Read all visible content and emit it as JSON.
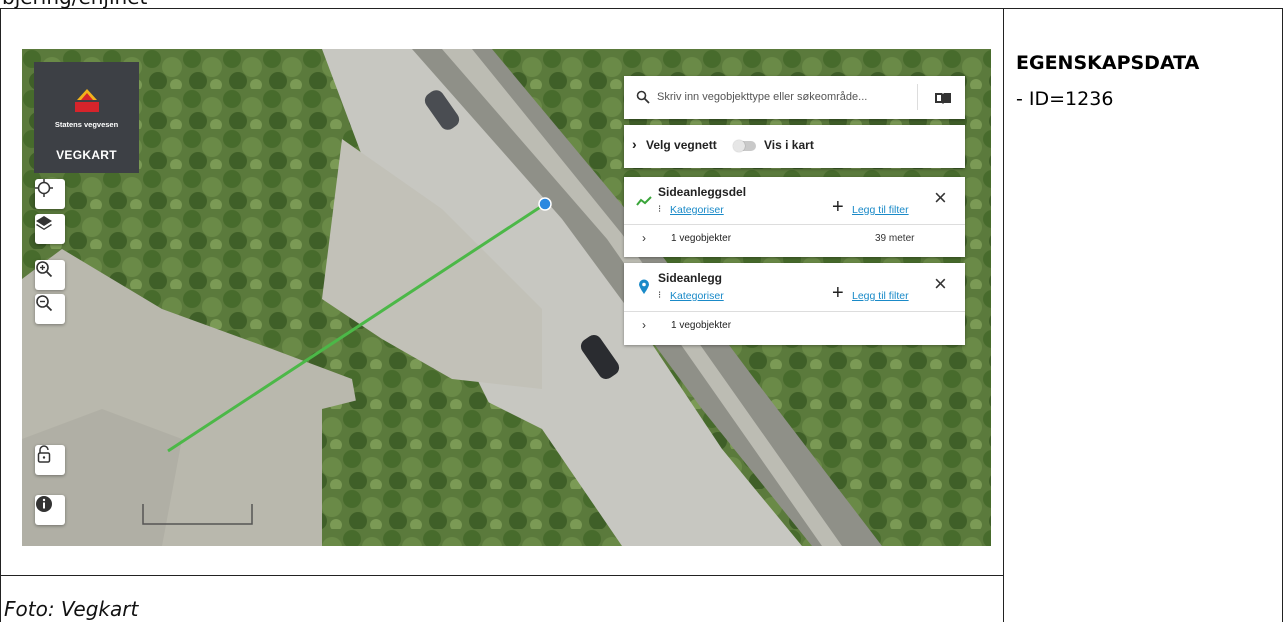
{
  "header": {
    "text": "bjering/ehjinet"
  },
  "right_panel": {
    "title": "EGENSKAPSDATA",
    "line1": "- ID=1236"
  },
  "caption": "Foto: Vegkart",
  "app": {
    "brand": "Statens vegvesen",
    "title": "VEGKART"
  },
  "map_controls": [
    "locate-icon",
    "layers-icon",
    "zoom-in-icon",
    "zoom-out-icon",
    "lock-icon",
    "info-icon"
  ],
  "search": {
    "placeholder": "Skriv inn vegobjekttype eller søkeområde..."
  },
  "vegnett": {
    "label": "Velg vegnett",
    "toggle_label": "Vis i kart",
    "toggle_on": false
  },
  "layers": [
    {
      "name": "Sideanleggsdel",
      "categorize": "Kategoriser",
      "add_filter": "Legg til filter",
      "count": "1 vegobjekter",
      "length": "39 meter",
      "icon": "line-icon",
      "color": "#3aa53a"
    },
    {
      "name": "Sideanlegg",
      "categorize": "Kategoriser",
      "add_filter": "Legg til filter",
      "count": "1 vegobjekter",
      "icon": "pin-icon",
      "color": "#1a8ac8"
    }
  ],
  "colors": {
    "accent": "#1a8ac8",
    "road_line": "#4cb848",
    "dark_panel": "#3d4045"
  }
}
